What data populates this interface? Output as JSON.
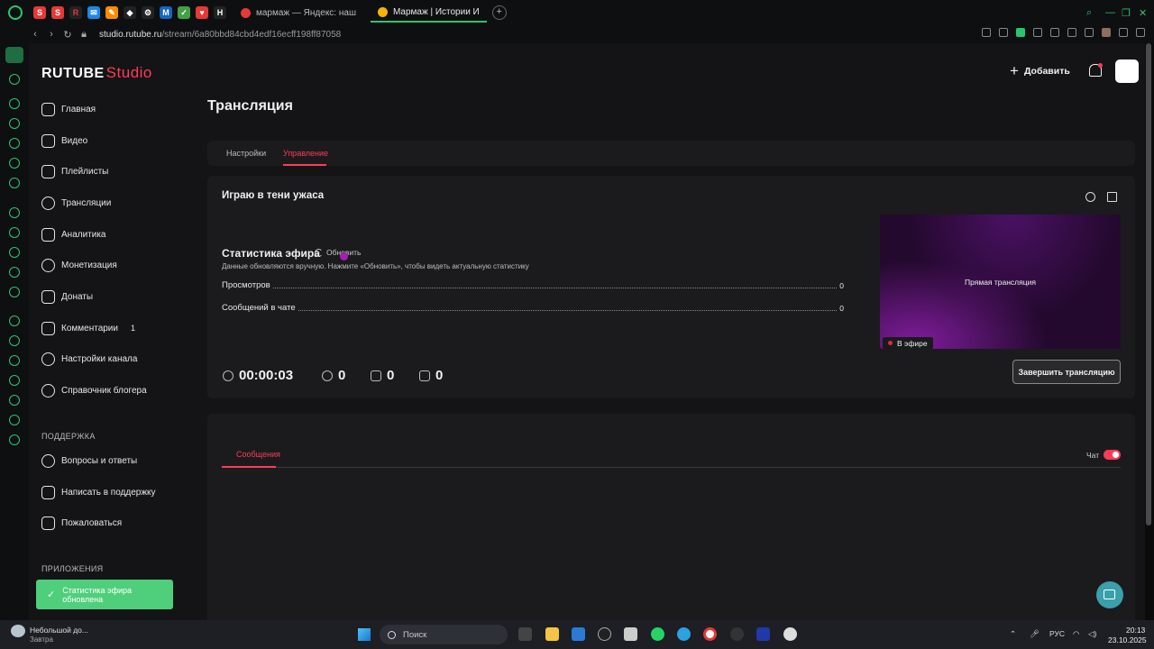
{
  "browser": {
    "tabs": [
      {
        "label": "мармаж — Яндекс: наш"
      },
      {
        "label": "Мармаж | Истории И"
      }
    ],
    "url_host": "studio.rutube.ru",
    "url_path": "/stream/6a80bbd84cbd4edf16ecff198ff87058"
  },
  "app": {
    "logo_main": "RUTUBE",
    "logo_studio": "Studio",
    "header": {
      "add_label": "Добавить"
    },
    "nav": [
      {
        "label": "Главная"
      },
      {
        "label": "Видео"
      },
      {
        "label": "Плейлисты"
      },
      {
        "label": "Трансляции"
      },
      {
        "label": "Аналитика"
      },
      {
        "label": "Монетизация"
      },
      {
        "label": "Донаты"
      },
      {
        "label": "Комментарии",
        "badge": "1"
      },
      {
        "label": "Настройки канала"
      },
      {
        "label": "Справочник блогера"
      }
    ],
    "support_title": "ПОДДЕРЖКА",
    "support": [
      {
        "label": "Вопросы и ответы"
      },
      {
        "label": "Написать в поддержку"
      },
      {
        "label": "Пожаловаться"
      }
    ],
    "apps_title": "ПРИЛОЖЕНИЯ",
    "toast": "Статистика эфира обновлена",
    "page_title": "Трансляция",
    "tabs": {
      "settings": "Настройки",
      "manage": "Управление"
    },
    "stream": {
      "title": "Играю в тени ужаса",
      "stats_title": "Статистика эфира",
      "refresh_label": "Обновить",
      "stats_note": "Данные обновляются вручную. Нажмите «Обновить», чтобы видеть актуальную статистику",
      "rows": [
        {
          "label": "Просмотров",
          "value": "0"
        },
        {
          "label": "Сообщений в чате",
          "value": "0"
        }
      ],
      "preview_title": "Прямая трансляция",
      "live_badge": "В эфире",
      "metrics": {
        "timer": "00:00:03",
        "viewers": "0",
        "likes": "0",
        "dislikes": "0"
      },
      "end_button": "Завершить трансляцию"
    },
    "chat": {
      "tab_messages": "Сообщения",
      "toggle_label": "Чат",
      "toggle_on": true
    }
  },
  "taskbar": {
    "weather_line1": "Небольшой до...",
    "weather_line2": "Завтра",
    "search_placeholder": "Поиск",
    "lang": "РУС",
    "time": "20:13",
    "date": "23.10.2025"
  },
  "colors": {
    "accent": "#ff3b58",
    "opera_green": "#28c76f",
    "toast": "#4fcf7b",
    "fab": "#3aa0ab"
  }
}
